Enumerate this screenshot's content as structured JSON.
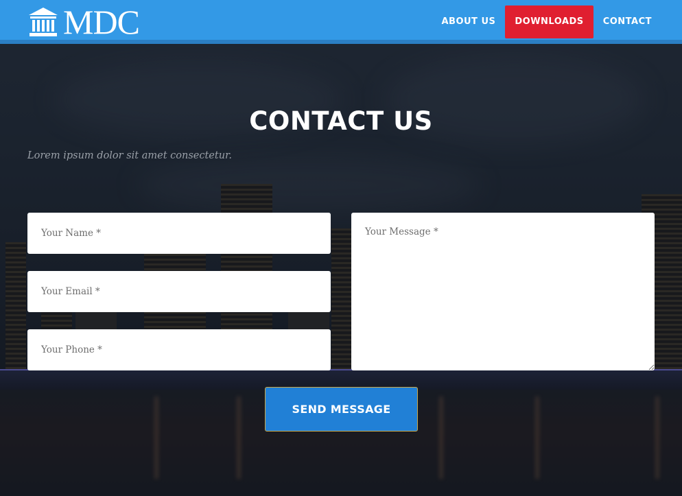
{
  "brand": {
    "name": "MDC",
    "icon": "building-columns-icon"
  },
  "nav": {
    "items": [
      {
        "label": "ABOUT US",
        "active": false
      },
      {
        "label": "DOWNLOADS",
        "active": true
      },
      {
        "label": "CONTACT",
        "active": false
      }
    ]
  },
  "contact": {
    "heading": "CONTACT US",
    "subheading": "Lorem ipsum dolor sit amet consectetur.",
    "fields": {
      "name_placeholder": "Your Name *",
      "email_placeholder": "Your Email *",
      "phone_placeholder": "Your Phone *",
      "message_placeholder": "Your Message *"
    },
    "submit_label": "SEND MESSAGE"
  },
  "colors": {
    "header": "#3399e6",
    "active_nav": "#e01f30",
    "button": "#2180d6"
  }
}
